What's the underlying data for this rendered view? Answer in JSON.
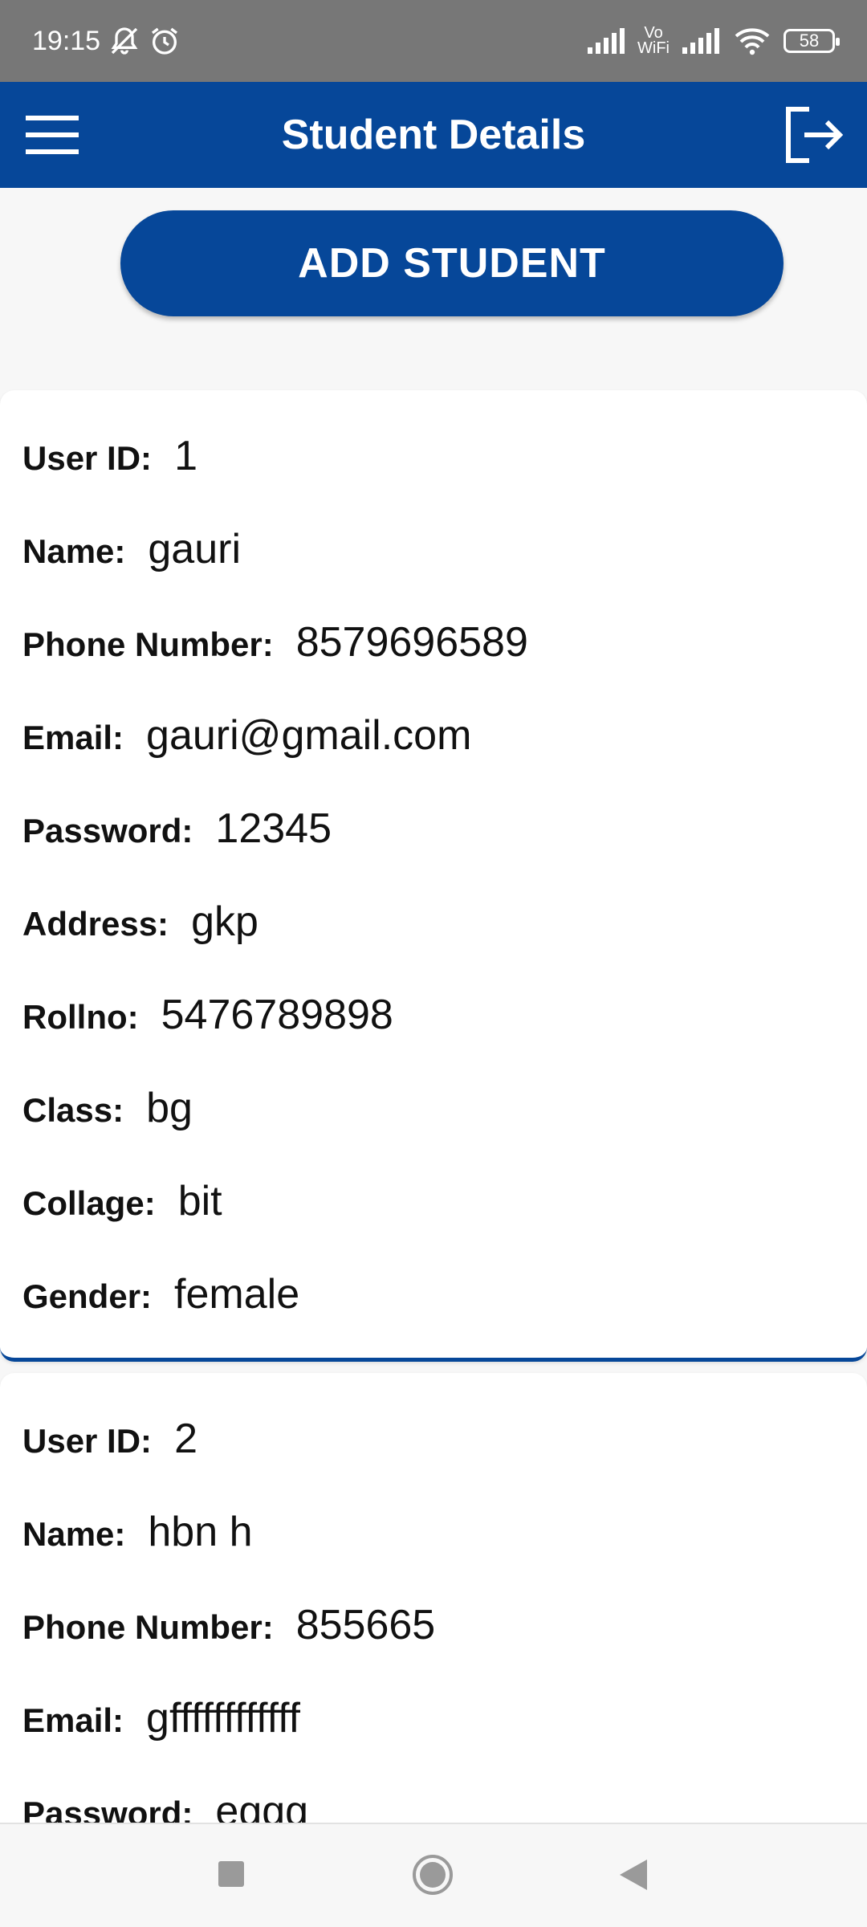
{
  "status_bar": {
    "time": "19:15",
    "vowifi_line1": "Vo",
    "vowifi_line2": "WiFi",
    "battery": "58"
  },
  "app_bar": {
    "title": "Student Details"
  },
  "actions": {
    "add_student_label": "ADD STUDENT"
  },
  "students": [
    {
      "fields": [
        {
          "label": "User ID:",
          "value": "1"
        },
        {
          "label": "Name:",
          "value": "gauri"
        },
        {
          "label": "Phone Number:",
          "value": "8579696589"
        },
        {
          "label": "Email:",
          "value": "gauri@gmail.com"
        },
        {
          "label": "Password:",
          "value": "12345"
        },
        {
          "label": "Address:",
          "value": "gkp"
        },
        {
          "label": "Rollno:",
          "value": "5476789898"
        },
        {
          "label": "Class:",
          "value": "bg"
        },
        {
          "label": "Collage:",
          "value": "bit"
        },
        {
          "label": "Gender:",
          "value": "female"
        }
      ]
    },
    {
      "fields": [
        {
          "label": "User ID:",
          "value": "2"
        },
        {
          "label": "Name:",
          "value": "hbn h"
        },
        {
          "label": "Phone Number:",
          "value": "855665"
        },
        {
          "label": "Email:",
          "value": "gffffffffffff"
        },
        {
          "label": "Password:",
          "value": "eggg"
        }
      ]
    }
  ],
  "colors": {
    "primary": "#064799",
    "status_bar": "#777777",
    "background": "#f7f7f7"
  }
}
